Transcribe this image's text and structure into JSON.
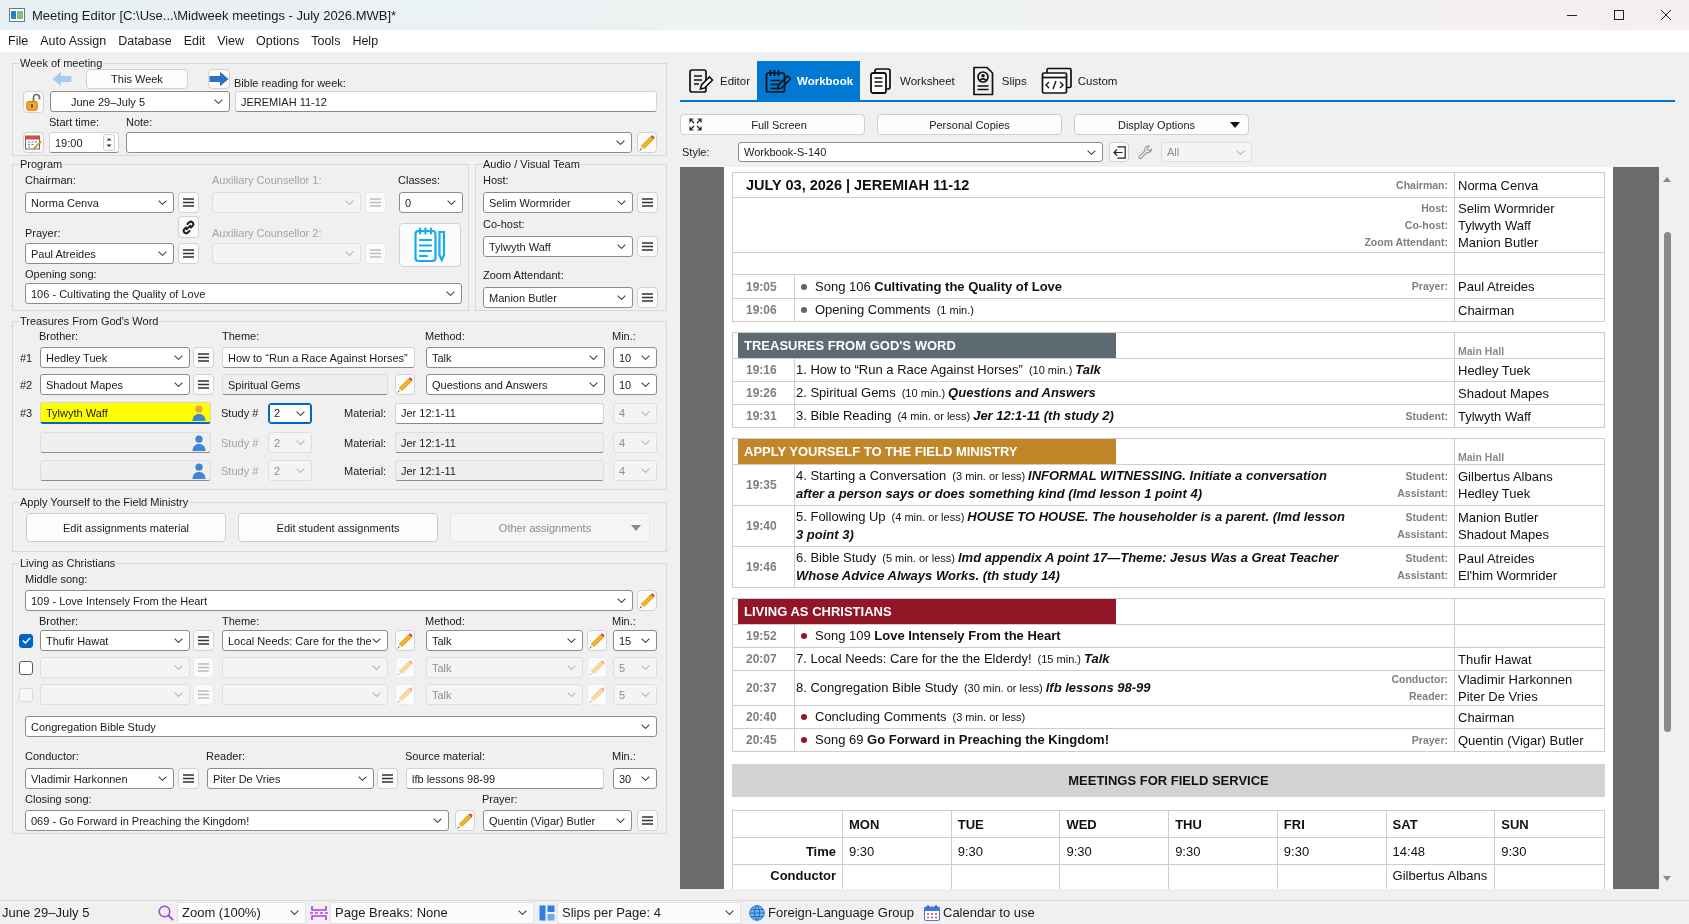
{
  "window": {
    "title": "Meeting Editor [C:\\Use...\\Midweek meetings - July 2026.MWB]*"
  },
  "menu": [
    "File",
    "Auto Assign",
    "Database",
    "Edit",
    "View",
    "Options",
    "Tools",
    "Help"
  ],
  "week_of_meeting": {
    "legend": "Week of meeting",
    "this_week": "This Week",
    "date": "June 29–July 5",
    "bible_reading_label": "Bible reading for week:",
    "bible_reading": "JEREMIAH 11-12",
    "start_time_label": "Start time:",
    "start_time": "19:00",
    "note_label": "Note:"
  },
  "program": {
    "legend": "Program",
    "chairman": {
      "label": "Chairman:",
      "value": "Norma Cenva"
    },
    "prayer": {
      "label": "Prayer:",
      "value": "Paul Atreides"
    },
    "auxiliary_counsellors": [
      {
        "label": "Auxiliary Counsellor 1:",
        "disabled": true
      },
      {
        "label": "Auxiliary Counsellor 2:",
        "disabled": true
      }
    ],
    "classes": {
      "label": "Classes:",
      "value": "0"
    },
    "opening_song": {
      "label": "Opening song:",
      "value": "106 - Cultivating the Quality of Love"
    }
  },
  "audio_visual": {
    "legend": "Audio / Visual Team",
    "roles": [
      {
        "label": "Host:",
        "value": "Selim Wormrider"
      },
      {
        "label": "Co-host:",
        "value": "Tylwyth Waff"
      },
      {
        "label": "Zoom Attendant:",
        "value": "Manion Butler"
      }
    ]
  },
  "treasures": {
    "legend": "Treasures From God's Word",
    "columns": [
      "Brother:",
      "Theme:",
      "Method:",
      "Min.:"
    ],
    "parts": [
      {
        "number": "#1",
        "brother": "Hedley Tuek",
        "theme": "How to “Run a Race Against Horses”",
        "theme_locked": false,
        "method": "Talk",
        "minutes": "10"
      },
      {
        "number": "#2",
        "brother": "Shadout Mapes",
        "theme": "Spiritual Gems",
        "theme_locked": true,
        "method": "Questions and Answers",
        "minutes": "10"
      }
    ],
    "reading": {
      "number": "#3",
      "students": [
        {
          "name": "Tylwyth Waff",
          "highlighted": true,
          "disabled": false,
          "study_label": "Study #",
          "study": "2",
          "study_focused": true,
          "material_label": "Material:",
          "material": "Jer 12:1-11",
          "minutes": "4",
          "minutes_disabled": true
        },
        {
          "highlighted": false,
          "disabled": true,
          "study_label": "Study #",
          "study": "2",
          "study_focused": false,
          "material_label": "Material:",
          "material": "Jer 12:1-11",
          "minutes": "4",
          "minutes_disabled": true
        },
        {
          "highlighted": false,
          "disabled": true,
          "study_label": "Study #",
          "study": "2",
          "study_focused": false,
          "material_label": "Material:",
          "material": "Jer 12:1-11",
          "minutes": "4",
          "minutes_disabled": true
        }
      ]
    }
  },
  "field_ministry": {
    "legend": "Apply Yourself to the Field Ministry",
    "buttons": [
      {
        "label": "Edit assignments material",
        "kind": "plain",
        "disabled": false
      },
      {
        "label": "Edit student assignments",
        "kind": "plain",
        "disabled": false
      },
      {
        "label": "Other assignments",
        "kind": "menu",
        "disabled": true
      }
    ]
  },
  "living": {
    "legend": "Living as Christians",
    "middle_song": {
      "label": "Middle song:",
      "value": "109 - Love Intensely From the Heart"
    },
    "columns": [
      "Brother:",
      "Theme:",
      "Method:",
      "Min.:"
    ],
    "parts": [
      {
        "checked": true,
        "checkbox_disabled": false,
        "disabled": false,
        "brother": "Thufir Hawat",
        "theme": "Local Needs: Care for the the",
        "method": "Talk",
        "minutes": "15"
      },
      {
        "checked": false,
        "checkbox_disabled": false,
        "disabled": true,
        "method": "Talk",
        "minutes": "5"
      },
      {
        "checked": false,
        "checkbox_disabled": true,
        "disabled": true,
        "method": "Talk",
        "minutes": "5"
      }
    ],
    "study_part": "Congregation Bible Study",
    "conductor": {
      "label": "Conductor:",
      "value": "Vladimir Harkonnen"
    },
    "reader": {
      "label": "Reader:",
      "value": "Piter De Vries"
    },
    "source_material": {
      "label": "Source material:",
      "value": "lfb lessons 98-99"
    },
    "minutes": {
      "label": "Min.:",
      "value": "30"
    },
    "closing_song": {
      "label": "Closing song:",
      "value": "069 - Go Forward in Preaching the Kingdom!"
    },
    "prayer": {
      "label": "Prayer:",
      "value": "Quentin (Vigar) Butler"
    }
  },
  "view_tabs": [
    {
      "label": "Editor",
      "kind": "editor",
      "selected": false
    },
    {
      "label": "Workbook",
      "kind": "workbook",
      "selected": true
    },
    {
      "label": "Worksheet",
      "kind": "worksheet",
      "selected": false
    },
    {
      "label": "Slips",
      "kind": "slips",
      "selected": false
    },
    {
      "label": "Custom",
      "kind": "custom",
      "selected": false
    }
  ],
  "toolbar": {
    "buttons": [
      {
        "label": "Full Screen",
        "kind": "fullscreen"
      },
      {
        "label": "Personal Copies",
        "kind": "plain"
      },
      {
        "label": "Display Options",
        "kind": "menu"
      }
    ],
    "style_label": "Style:",
    "style": "Workbook-S-140",
    "tool_buttons": [
      {
        "kind": "export",
        "disabled": false
      },
      {
        "kind": "settings",
        "disabled": true
      }
    ],
    "filter": {
      "value": "All",
      "disabled": true
    }
  },
  "workbook": {
    "heading": "JULY 03, 2026 | JEREMIAH 11-12",
    "chairman": {
      "role": "Chairman:",
      "name": "Norma Cenva"
    },
    "team": [
      {
        "role": "Host:",
        "name": "Selim Wormrider"
      },
      {
        "role": "Co-host:",
        "name": "Tylwyth Waff"
      },
      {
        "role": "Zoom Attendant:",
        "name": "Manion Butler"
      }
    ],
    "opening": [
      {
        "time": "19:05",
        "kind": "bullet",
        "title": "Song 106 **Cultivating the Quality of Love**",
        "assignees": [
          {
            "role": "Prayer:",
            "name": "Paul Atreides"
          }
        ]
      },
      {
        "time": "19:06",
        "kind": "bullet",
        "title": "Opening Comments",
        "duration": "(1 min.)",
        "assignees": [
          {
            "name": "Chairman"
          }
        ]
      }
    ],
    "sections": [
      {
        "title": "TREASURES FROM GOD'S WORD",
        "color": "#5e6a71",
        "hall": "Main Hall",
        "items": [
          {
            "time": "19:16",
            "kind": "numbered",
            "title": "1. How to “Run a Race Against Horses”",
            "duration": "(10 min.)",
            "detail": "Talk",
            "assignees": [
              {
                "name": "Hedley Tuek"
              }
            ]
          },
          {
            "time": "19:26",
            "kind": "numbered",
            "title": "2. Spiritual Gems",
            "duration": "(10 min.)",
            "detail": "Questions and Answers",
            "assignees": [
              {
                "name": "Shadout Mapes"
              }
            ]
          },
          {
            "time": "19:31",
            "kind": "numbered",
            "title": "3. Bible Reading",
            "duration": "(4 min. or less)",
            "detail": "Jer 12:1-11 (th study 2)",
            "assignees": [
              {
                "role": "Student:",
                "name": "Tylwyth Waff"
              }
            ]
          }
        ]
      },
      {
        "title": "APPLY YOURSELF TO THE FIELD MINISTRY",
        "color": "#c08628",
        "hall": "Main Hall",
        "items": [
          {
            "time": "19:35",
            "kind": "numbered",
            "title": "4. Starting a Conversation",
            "duration": "(3 min. or less)",
            "detail": "INFORMAL WITNESSING. Initiate a conversation after a person says or does something kind (lmd lesson 1 point 4)",
            "assignees": [
              {
                "role": "Student:",
                "name": "Gilbertus Albans"
              },
              {
                "role": "Assistant:",
                "name": "Hedley Tuek"
              }
            ]
          },
          {
            "time": "19:40",
            "kind": "numbered",
            "title": "5. Following Up",
            "duration": "(4 min. or less)",
            "detail": "HOUSE TO HOUSE. The householder is a parent. (lmd lesson 3 point 3)",
            "assignees": [
              {
                "role": "Student:",
                "name": "Manion Butler"
              },
              {
                "role": "Assistant:",
                "name": "Shadout Mapes"
              }
            ]
          },
          {
            "time": "19:46",
            "kind": "numbered",
            "title": "6. Bible Study",
            "duration": "(5 min. or less)",
            "detail": "lmd appendix A point 17—Theme: Jesus Was a Great Teacher Whose Advice Always Works. (th study 14)",
            "assignees": [
              {
                "role": "Student:",
                "name": "Paul Atreides"
              },
              {
                "role": "Assistant:",
                "name": "El'him Wormrider"
              }
            ]
          }
        ]
      },
      {
        "title": "LIVING AS CHRISTIANS",
        "color": "#931628",
        "items": [
          {
            "time": "19:52",
            "kind": "bullet",
            "title": "Song 109 **Love Intensely From the Heart**"
          },
          {
            "time": "20:07",
            "kind": "numbered",
            "title": "7. Local Needs: Care for the the Elderdy!",
            "duration": "(15 min.)",
            "detail": "Talk",
            "assignees": [
              {
                "name": "Thufir Hawat"
              }
            ]
          },
          {
            "time": "20:37",
            "kind": "numbered",
            "title": "8. Congregation Bible Study",
            "duration": "(30 min. or less)",
            "detail": "lfb lessons 98-99",
            "assignees": [
              {
                "role": "Conductor:",
                "name": "Vladimir Harkonnen"
              },
              {
                "role": "Reader:",
                "name": "Piter De Vries"
              }
            ]
          },
          {
            "time": "20:40",
            "kind": "bullet",
            "title": "Concluding Comments",
            "duration": "(3 min. or less)",
            "assignees": [
              {
                "name": "Chairman"
              }
            ]
          },
          {
            "time": "20:45",
            "kind": "bullet",
            "title": "Song 69 **Go Forward in Preaching the Kingdom!**",
            "assignees": [
              {
                "role": "Prayer:",
                "name": "Quentin (Vigar) Butler"
              }
            ]
          }
        ]
      }
    ],
    "field_service": {
      "title": "MEETINGS FOR FIELD SERVICE",
      "row_labels": [
        "Time",
        "Conductor"
      ],
      "days": [
        {
          "day": "MON",
          "values": [
            "9:30"
          ]
        },
        {
          "day": "TUE",
          "values": [
            "9:30"
          ]
        },
        {
          "day": "WED",
          "values": [
            "9:30"
          ]
        },
        {
          "day": "THU",
          "values": [
            "9:30"
          ]
        },
        {
          "day": "FRI",
          "values": [
            "9:30"
          ]
        },
        {
          "day": "SAT",
          "values": [
            "14:48",
            "Gilbertus Albans"
          ]
        },
        {
          "day": "SUN",
          "values": [
            "9:30"
          ]
        }
      ]
    }
  },
  "status_bar": {
    "week": "June 29–July 5",
    "zoom": "Zoom (100%)",
    "page_breaks": "Page Breaks: None",
    "slips": "Slips per Page: 4",
    "links": [
      {
        "label": "Foreign-Language Group",
        "kind": "globe"
      },
      {
        "label": "Calendar to use",
        "kind": "calendar"
      }
    ]
  }
}
